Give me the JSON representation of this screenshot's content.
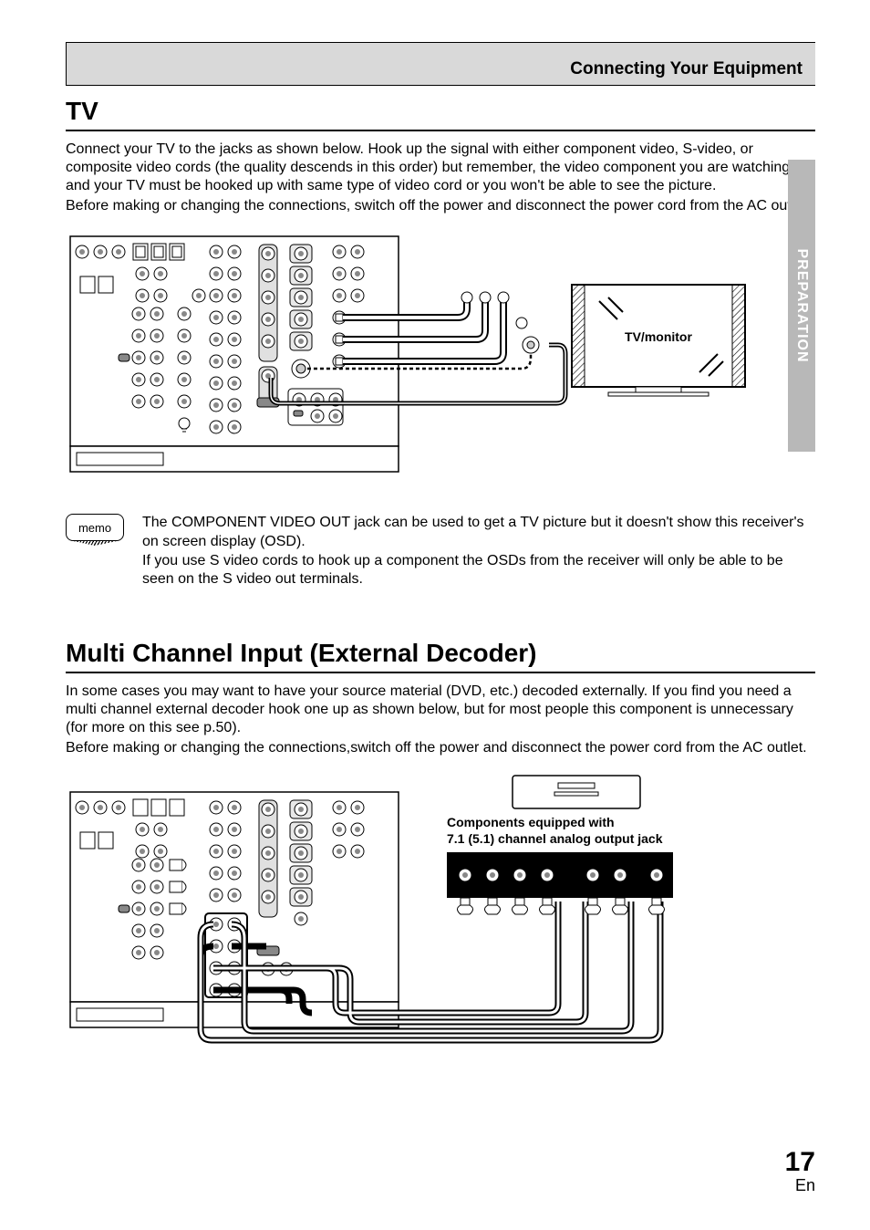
{
  "header": {
    "section": "Connecting Your Equipment"
  },
  "side_tab": "PREPARATION",
  "page": {
    "number": "17",
    "lang": "En"
  },
  "tv": {
    "heading": "TV",
    "para1": "Connect your TV to the jacks as shown below. Hook up the signal with either component video, S-video, or composite video cords (the quality descends in this order) but remember, the video component you are watching and your TV must be hooked up with same type of video cord or you won't be able to see the picture.",
    "para2": "Before making or changing the connections, switch off the power and disconnect the power cord from the AC outlet.",
    "diagram": {
      "tv_label": "TV/monitor"
    }
  },
  "memo": {
    "label": "memo",
    "line1": "The COMPONENT VIDEO OUT jack can be used to get a TV picture but it doesn't show this receiver's on screen display (OSD).",
    "line2": "If you use S video cords to hook up a component the OSDs from the receiver will only be able to be seen on the S video out terminals."
  },
  "multi": {
    "heading": "Multi Channel Input (External Decoder)",
    "para1": "In some cases you may want to have your source material (DVD, etc.) decoded externally. If you find you need a multi channel external decoder hook one up as shown below, but for most people this component is unnecessary (for more on this see p.50).",
    "para2": "Before making or changing the connections,switch off the power and disconnect the power cord from the AC outlet.",
    "diagram": {
      "caption1": "Components equipped with",
      "caption2": "7.1 (5.1) channel analog output jack"
    }
  }
}
